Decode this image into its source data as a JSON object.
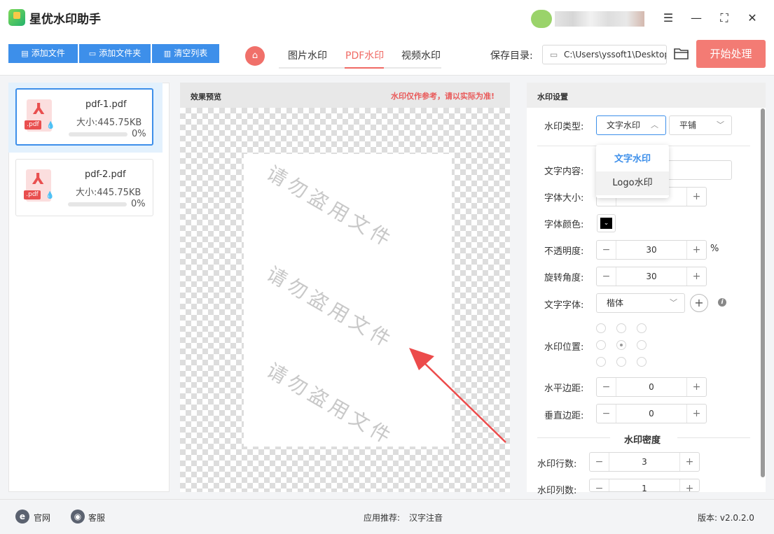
{
  "app": {
    "title": "星优水印助手"
  },
  "toolbar": {
    "add_file": "添加文件",
    "add_folder": "添加文件夹",
    "clear_list": "清空列表",
    "tabs": [
      "图片水印",
      "PDF水印",
      "视频水印"
    ],
    "active_tab": "PDF水印",
    "save_dir_label": "保存目录:",
    "save_dir_value": "C:\\Users\\yssoft1\\Desktop",
    "start_button": "开始处理"
  },
  "files": [
    {
      "name": "pdf-1.pdf",
      "size": "大小:445.75KB",
      "progress": "0%",
      "selected": true
    },
    {
      "name": "pdf-2.pdf",
      "size": "大小:445.75KB",
      "progress": "0%",
      "selected": false
    }
  ],
  "preview": {
    "title": "效果预览",
    "note": "水印仅作参考，请以实际为准!",
    "watermark_text": "请勿盗用文件"
  },
  "settings": {
    "title": "水印设置",
    "type_label": "水印类型:",
    "type_value": "文字水印",
    "layout_value": "平铺",
    "dropdown_options": [
      "文字水印",
      "Logo水印"
    ],
    "text_content_label": "文字内容:",
    "font_size_label": "字体大小:",
    "font_color_label": "字体颜色:",
    "font_color": "#000000",
    "opacity_label": "不透明度:",
    "opacity_value": "30",
    "opacity_unit": "%",
    "rotation_label": "旋转角度:",
    "rotation_value": "30",
    "font_family_label": "文字字体:",
    "font_family_value": "楷体",
    "position_label": "水印位置:",
    "h_margin_label": "水平边距:",
    "h_margin_value": "0",
    "v_margin_label": "垂直边距:",
    "v_margin_value": "0",
    "density_section": "水印密度",
    "rows_label": "水印行数:",
    "rows_value": "3",
    "cols_label": "水印列数:",
    "cols_value": "1"
  },
  "footer": {
    "website": "官网",
    "support": "客服",
    "recommend_label": "应用推荐:",
    "recommend_app": "汉字注音",
    "version": "版本: v2.0.2.0"
  },
  "colors": {
    "primary": "#3d8fea",
    "accent": "#f37b74"
  }
}
